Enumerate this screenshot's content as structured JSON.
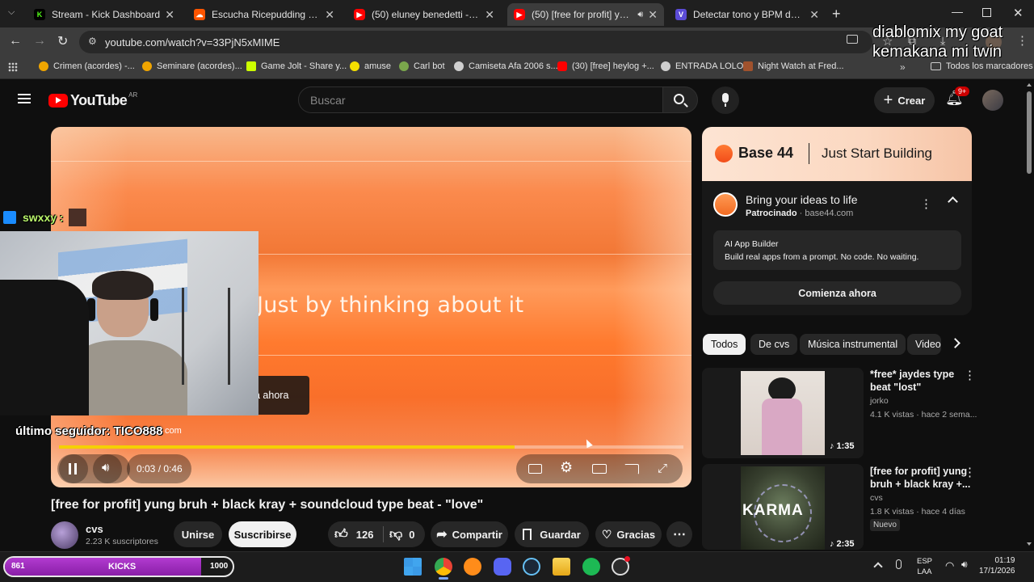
{
  "browser": {
    "tabs": [
      {
        "title": "Stream - Kick Dashboard",
        "icon": "kick-icon",
        "color": "#53fc18"
      },
      {
        "title": "Escucha Ricepudding de TiCO |",
        "icon": "soundcloud-icon",
        "color": "#ff5500"
      },
      {
        "title": "(50) eluney benedetti - El Morf",
        "icon": "youtube-icon",
        "color": "#ff0000"
      },
      {
        "title": "(50) [free for profit] yung b",
        "icon": "youtube-icon",
        "color": "#ff0000"
      },
      {
        "title": "Detectar tono y BPM de canció",
        "icon": "v-icon",
        "color": "#5b4bd6"
      }
    ],
    "url": "youtube.com/watch?v=33PjN5xMIME",
    "bookmarks": [
      {
        "label": "Crimen (acordes) -...",
        "color": "#f0a500"
      },
      {
        "label": "Seminare (acordes)...",
        "color": "#f0a500"
      },
      {
        "label": "Game Jolt - Share y...",
        "color": "#ccff00"
      },
      {
        "label": "amuse",
        "color": "#f5e000"
      },
      {
        "label": "Carl bot",
        "color": "#7aa74c"
      },
      {
        "label": "Camiseta Afa 2006 s...",
        "color": "#cfcfcf"
      },
      {
        "label": "(30) [free] heylog +...",
        "color": "#ff0000"
      },
      {
        "label": "ENTRADA LOLO",
        "color": "#cfcfcf"
      },
      {
        "label": "Night Watch at Fred...",
        "color": "#a0522d"
      }
    ],
    "all_bookmarks": "Todos los marcadores"
  },
  "stream_overlay": {
    "top_text_line1": "diablomix my goat",
    "top_text_line2": "kemakana mi twin",
    "chat_user": "swxxy :",
    "last_follower": "último seguidor: TICO888",
    "goal_current": "861",
    "goal_label": "KICKS",
    "goal_target": "1000",
    "goal_progress": 0.861,
    "ad_ahora": "a ahora",
    "url_fragment": "com"
  },
  "youtube": {
    "logo_text": "YouTube",
    "region": "AR",
    "search_placeholder": "Buscar",
    "create_label": "Crear",
    "notif_count": "9+",
    "player": {
      "caption": "Just by thinking about it",
      "time": "0:03 / 0:46",
      "progress": 0.73
    },
    "video_title": "[free for profit] yung bruh + black kray + soundcloud type beat - \"love\"",
    "channel": "cvs",
    "subscribers": "2.23 K suscriptores",
    "join_label": "Unirse",
    "subscribe_label": "Suscribirse",
    "likes": "126",
    "dislikes": "0",
    "share_label": "Compartir",
    "save_label": "Guardar",
    "thanks_label": "Gracias",
    "ad": {
      "banner_brand": "Base 44",
      "banner_tagline": "Just Start Building",
      "headline": "Bring your ideas to life",
      "sponsored": "Patrocinado",
      "domain": "base44.com",
      "card_title": "AI App Builder",
      "card_text": "Build real apps from a prompt. No code. No waiting.",
      "cta": "Comienza ahora"
    },
    "chips": [
      "Todos",
      "De cvs",
      "Música instrumental",
      "Video"
    ],
    "recommendations": [
      {
        "title_line1": "*free* jaydes type",
        "title_line2": "beat \"lost\"",
        "channel": "jorko",
        "meta": "4.1 K vistas · hace 2 sema...",
        "duration": "1:35",
        "badge": ""
      },
      {
        "title_line1": "[free for profit] yung",
        "title_line2": "bruh + black kray +...",
        "channel": "cvs",
        "meta": "1.8 K vistas · hace 4 días",
        "duration": "2:35",
        "badge": "Nuevo",
        "thumb_text": "KARMA"
      }
    ]
  },
  "taskbar": {
    "lang1": "ESP",
    "lang2": "LAA",
    "time": "01:19",
    "date": "17/1/2026"
  }
}
